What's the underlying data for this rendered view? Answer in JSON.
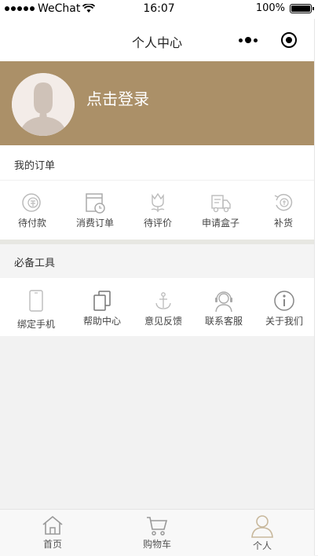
{
  "status_bar": {
    "carrier": "WeChat",
    "time": "16:07",
    "battery": "100%"
  },
  "nav": {
    "title": "个人中心"
  },
  "profile": {
    "login_text": "点击登录",
    "bg_color": "#ab9068"
  },
  "orders": {
    "title": "我的订单",
    "items": [
      {
        "label": "待付款",
        "icon": "coin-pay-icon"
      },
      {
        "label": "消费订单",
        "icon": "order-clock-icon"
      },
      {
        "label": "待评价",
        "icon": "tulip-review-icon"
      },
      {
        "label": "申请盒子",
        "icon": "delivery-truck-icon"
      },
      {
        "label": "补货",
        "icon": "restock-icon"
      }
    ]
  },
  "tools": {
    "title": "必备工具",
    "items": [
      {
        "label": "绑定手机",
        "icon": "phone-icon"
      },
      {
        "label": "帮助中心",
        "icon": "copy-pages-icon"
      },
      {
        "label": "意见反馈",
        "icon": "anchor-icon"
      },
      {
        "label": "联系客服",
        "icon": "headset-icon"
      },
      {
        "label": "关于我们",
        "icon": "info-icon"
      }
    ]
  },
  "tabbar": {
    "items": [
      {
        "label": "首页",
        "icon": "home-icon"
      },
      {
        "label": "购物车",
        "icon": "cart-icon"
      },
      {
        "label": "个人",
        "icon": "person-icon",
        "active": true
      }
    ]
  }
}
